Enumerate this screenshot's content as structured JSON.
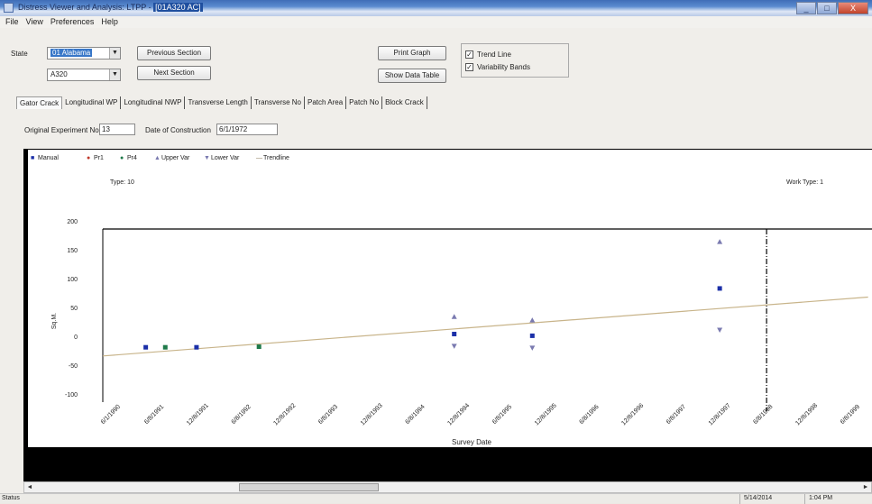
{
  "window": {
    "title_prefix": "Distress Viewer and Analysis: LTPP - ",
    "title_section": "[01A320 AC]",
    "min": "_",
    "max": "□",
    "close": "X"
  },
  "menu": [
    "File",
    "View",
    "Preferences",
    "Help"
  ],
  "controls": {
    "state_label": "State",
    "state_value": "01 Alabama",
    "section_value": "A320",
    "prev_section": "Previous Section",
    "next_section": "Next Section",
    "print_graph": "Print Graph",
    "show_data_table": "Show Data Table",
    "trend_line_label": "Trend Line",
    "trend_line_checked": true,
    "variability_label": "Variability Bands",
    "variability_checked": true
  },
  "tabs": [
    "Gator Crack",
    "Longitudinal WP",
    "Longitudinal NWP",
    "Transverse Length",
    "Transverse No",
    "Patch Area",
    "Patch No",
    "Block Crack"
  ],
  "active_tab": 0,
  "info": {
    "experiment_label": "Original Experiment No.",
    "experiment_value": "13",
    "construction_label": "Date of Construction",
    "construction_value": "6/1/1972"
  },
  "chart_data": {
    "type": "scatter",
    "legend": [
      "Manual",
      "Pr1",
      "Pr4",
      "Upper Var",
      "Lower Var",
      "Trendline"
    ],
    "legend_placement": "top-left",
    "type_label": "Type: 10",
    "work_type_label": "Work Type: 1",
    "xlabel": "Survey Date",
    "ylabel": "Sq.M.",
    "ylim": [
      -100,
      200
    ],
    "yticks": [
      "200",
      "150",
      "100",
      "50",
      "0",
      "-50",
      "-100"
    ],
    "xticks": [
      "6/1/1990",
      "6/8/1991",
      "12/8/1991",
      "6/8/1992",
      "12/8/1992",
      "6/8/1993",
      "12/8/1993",
      "6/8/1994",
      "12/8/1994",
      "6/8/1995",
      "12/8/1995",
      "6/8/1996",
      "12/8/1996",
      "6/8/1997",
      "12/8/1997",
      "6/8/1998",
      "12/8/1998",
      "6/8/1999"
    ],
    "series": [
      {
        "name": "Manual",
        "color": "#1b2fa8",
        "points": [
          [
            1990.55,
            -5
          ],
          [
            1991.2,
            -5
          ],
          [
            1994.5,
            18
          ],
          [
            1995.5,
            15
          ],
          [
            1997.9,
            97
          ]
        ]
      },
      {
        "name": "Pr4",
        "color": "#1f7a4a",
        "points": [
          [
            1990.8,
            -5
          ],
          [
            1992.0,
            -4
          ]
        ]
      },
      {
        "name": "Upper Var",
        "color": "#7a7ab0",
        "points": [
          [
            1994.5,
            48
          ],
          [
            1995.5,
            42
          ],
          [
            1997.9,
            178
          ]
        ]
      },
      {
        "name": "Lower Var",
        "color": "#7a7ab0",
        "points": [
          [
            1994.5,
            -3
          ],
          [
            1995.5,
            -6
          ],
          [
            1997.9,
            25
          ]
        ]
      }
    ],
    "trendline": {
      "x": [
        1990.0,
        1999.8
      ],
      "y": [
        -20,
        82
      ],
      "color": "#c8b48a"
    },
    "work_event_x": 1998.5
  },
  "hscroll": {
    "left": "◄",
    "right": "►"
  },
  "status": {
    "text": "Status",
    "date": "5/14/2014",
    "time": "1:04 PM"
  }
}
